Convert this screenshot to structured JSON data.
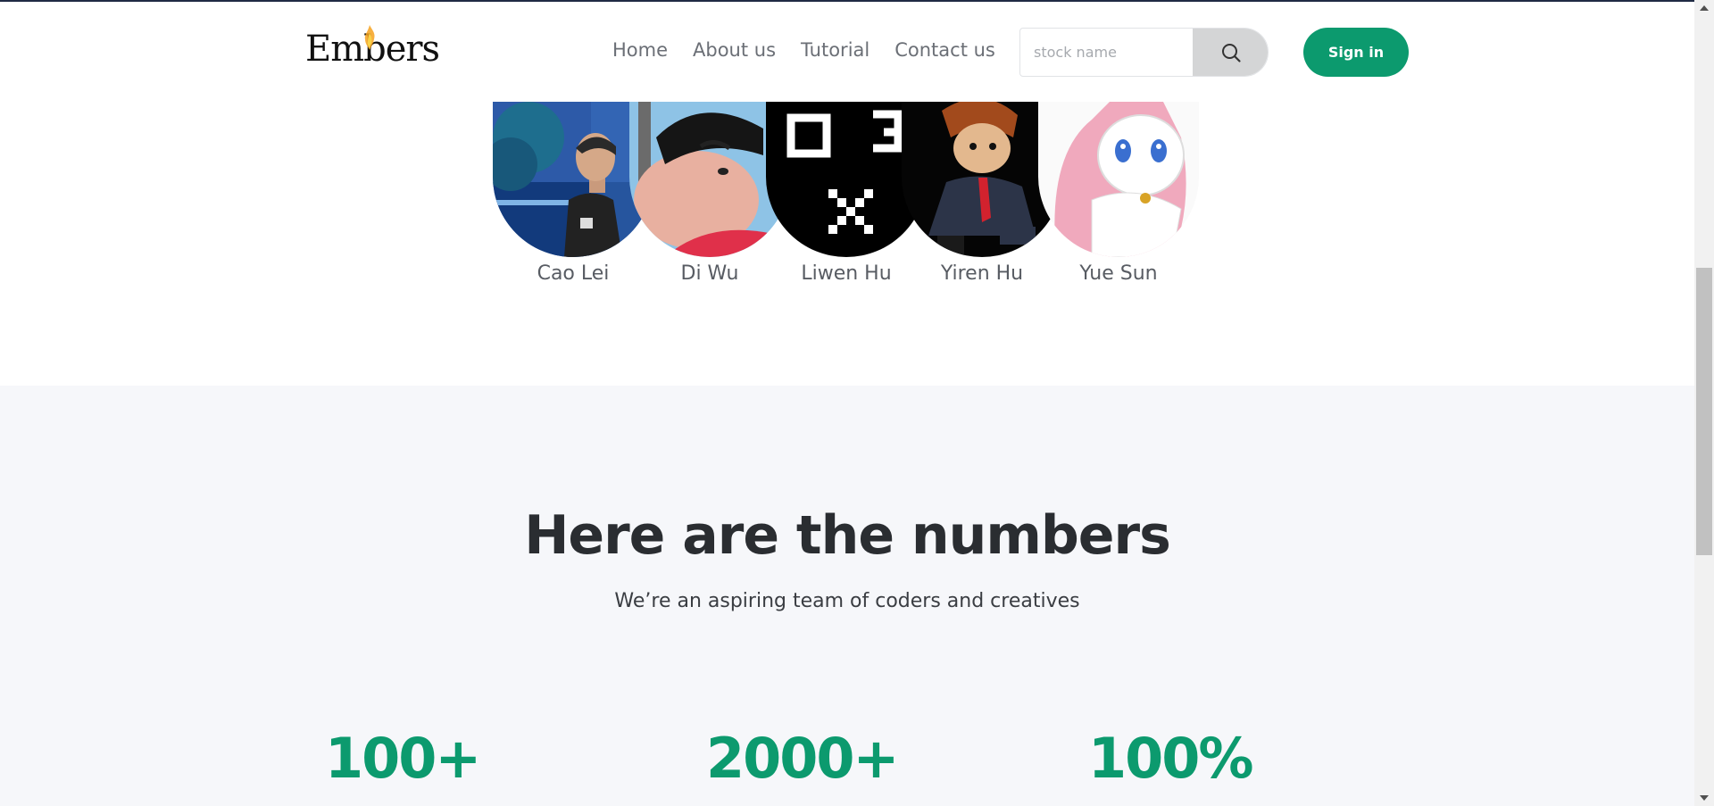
{
  "header": {
    "logo_text": "Embers",
    "nav": [
      "Home",
      "About us",
      "Tutorial",
      "Contact us"
    ],
    "search_placeholder": "stock name",
    "signin_label": "Sign in"
  },
  "team": {
    "members": [
      {
        "name": "Cao Lei",
        "avatar": "man-photo-avatar"
      },
      {
        "name": "Di Wu",
        "avatar": "cartoon-avatar"
      },
      {
        "name": "Liwen Hu",
        "avatar": "pixel-symbols-avatar"
      },
      {
        "name": "Yiren Hu",
        "avatar": "cartoon-boy-avatar"
      },
      {
        "name": "Yue Sun",
        "avatar": "anime-cat-avatar"
      }
    ]
  },
  "numbers": {
    "title": "Here are the numbers",
    "subtitle": "We’re an aspiring team of coders and creatives",
    "stats": [
      "100+",
      "2000+",
      "100%"
    ]
  },
  "colors": {
    "accent": "#0c9a6e",
    "section_bg": "#f6f7fa",
    "search_button": "#d4d5d6"
  }
}
